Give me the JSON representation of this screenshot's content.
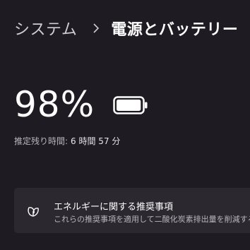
{
  "breadcrumb": {
    "parent": "システム",
    "separator_icon": "chevron-right-icon",
    "current": "電源とバッテリー"
  },
  "battery": {
    "percent_label": "98%",
    "level_fraction": 0.98,
    "icon": "battery-full-icon",
    "remaining_label": "推定残り時間:",
    "remaining_value": "6 時間 57 分"
  },
  "recommendations": {
    "icon": "leaf-icon",
    "title": "エネルギーに関する推奨事項",
    "description": "これらの推奨事項を適用して二酸化炭素排出量を削減する"
  },
  "colors": {
    "background": "#1e1b22",
    "card": "#2b282f",
    "text_primary": "#ffffff",
    "text_secondary": "#b9b6bd"
  }
}
